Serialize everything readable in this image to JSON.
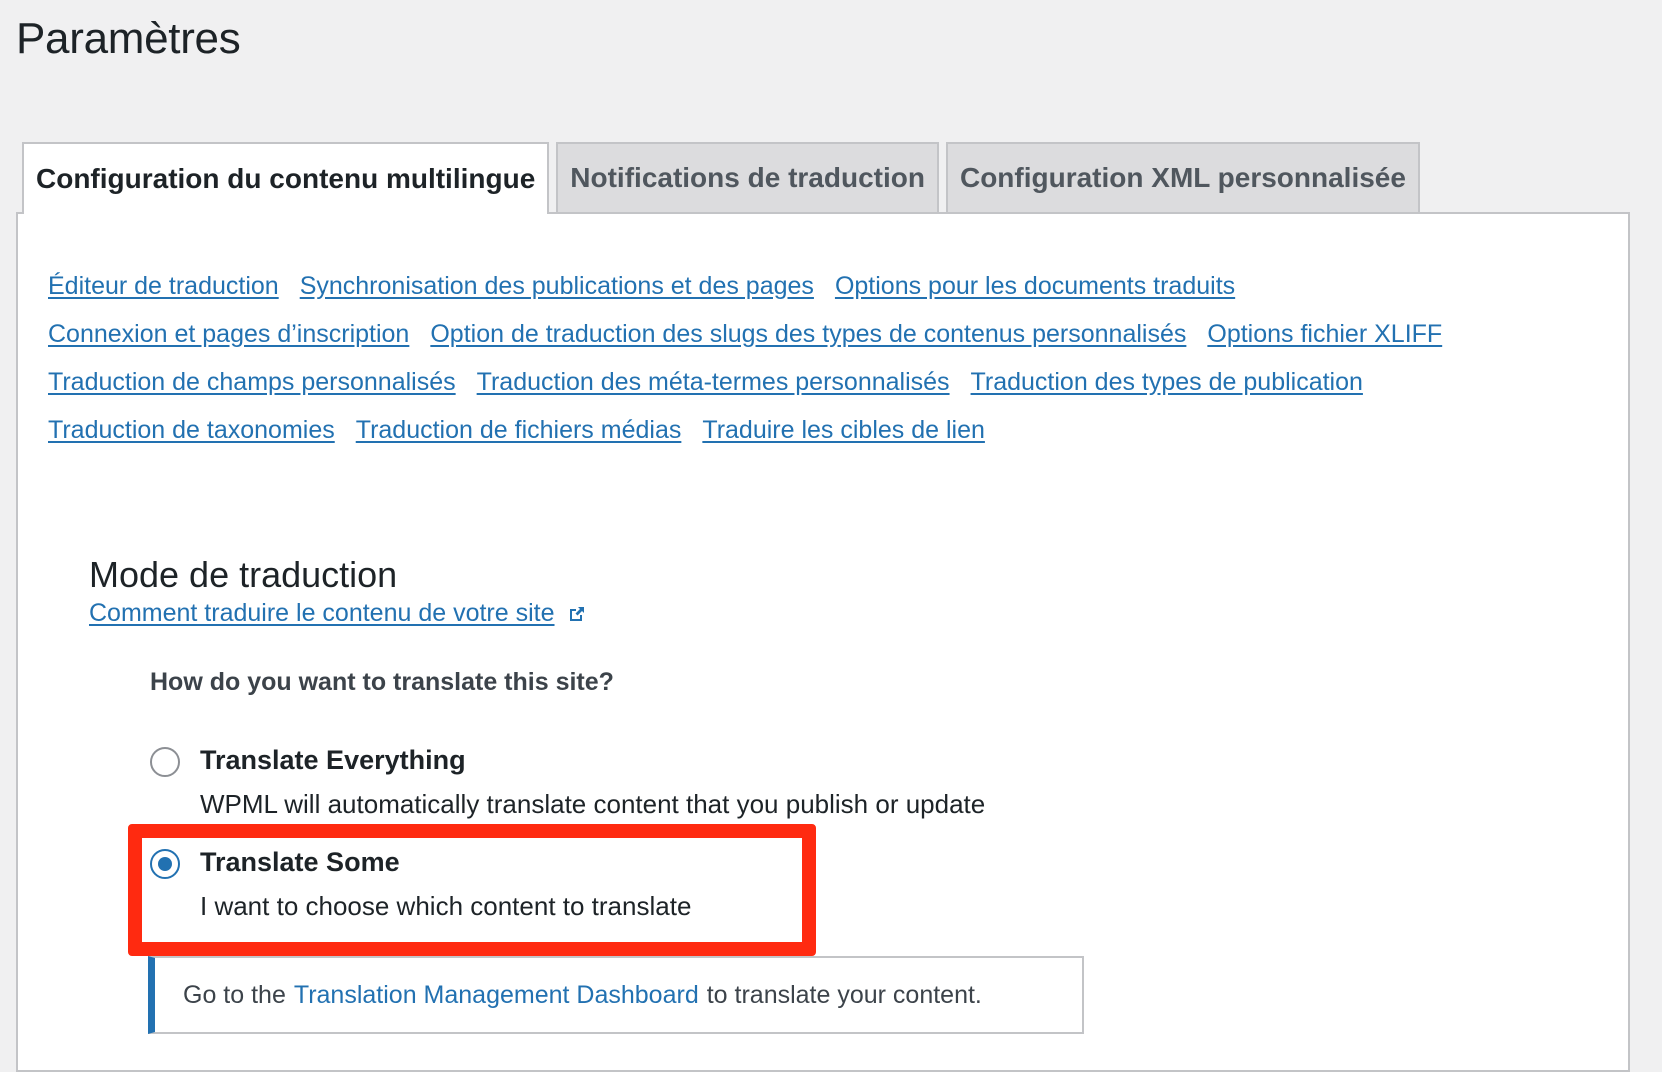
{
  "page": {
    "title": "Paramètres"
  },
  "tabs": [
    {
      "label": "Configuration du contenu multilingue",
      "active": true
    },
    {
      "label": "Notifications de traduction",
      "active": false
    },
    {
      "label": "Configuration XML personnalisée",
      "active": false
    }
  ],
  "links": {
    "row1": [
      "Éditeur de traduction",
      "Synchronisation des publications et des pages",
      "Options pour les documents traduits"
    ],
    "row2": [
      "Connexion et pages d’inscription",
      "Option de traduction des slugs des types de contenus personnalisés",
      "Options fichier XLIFF"
    ],
    "row3": [
      "Traduction de champs personnalisés",
      "Traduction des méta-termes personnalisés",
      "Traduction des types de publication"
    ],
    "row4": [
      "Traduction de taxonomies",
      "Traduction de fichiers médias",
      "Traduire les cibles de lien"
    ]
  },
  "mode": {
    "title": "Mode de traduction",
    "help_link": "Comment traduire le contenu de votre site",
    "question": "How do you want to translate this site?",
    "options": [
      {
        "label": "Translate Everything",
        "description": "WPML will automatically translate content that you publish or update",
        "checked": false
      },
      {
        "label": "Translate Some",
        "description": "I want to choose which content to translate",
        "checked": true
      }
    ],
    "notice": {
      "prefix": "Go to the",
      "link": "Translation Management Dashboard",
      "suffix": "to translate your content."
    }
  },
  "colors": {
    "accent": "#2271b1",
    "highlight": "#ff2a10",
    "background": "#f0f0f1"
  },
  "icons": {
    "external": "external-link-icon",
    "radio": "radio-button"
  }
}
